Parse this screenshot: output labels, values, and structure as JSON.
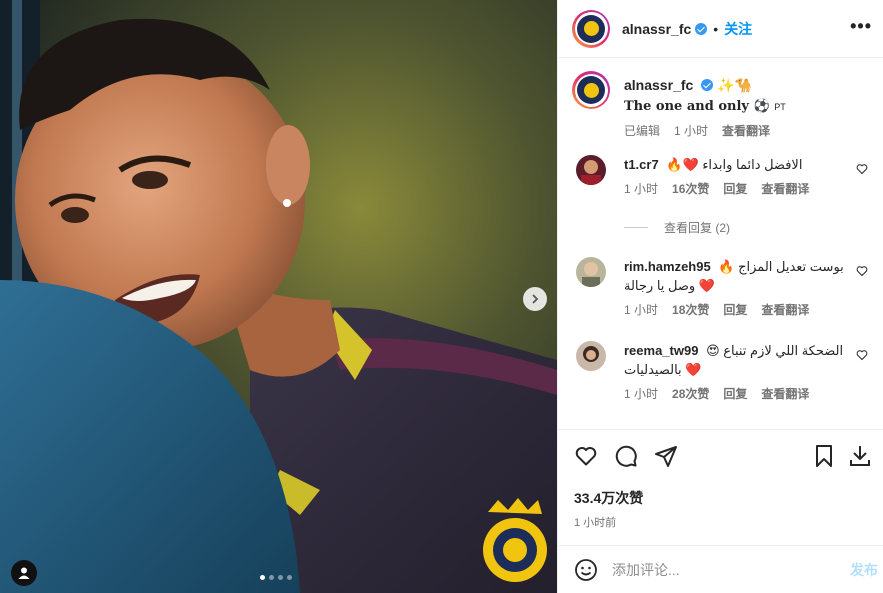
{
  "header": {
    "username": "alnassr_fc",
    "separator": "•",
    "follow_label": "关注",
    "more_label": "•••"
  },
  "caption": {
    "username": "alnassr_fc",
    "emoji": "✨🐪",
    "text": "The one and only ⚽",
    "tag": "PT",
    "edited": "已编辑",
    "time": "1 小时",
    "translate": "查看翻译"
  },
  "comments": [
    {
      "username": "t1.cr7",
      "text": "الافضل دائما وابداء ❤️🔥",
      "time": "1 小时",
      "likes": "16次赞",
      "reply": "回复",
      "translate": "查看翻译"
    },
    {
      "username": "rim.hamzeh95",
      "text": "بوست تعديل المزاج 🔥❤️ وصل يا رجالة",
      "time": "1 小时",
      "likes": "18次赞",
      "reply": "回复",
      "translate": "查看翻译"
    },
    {
      "username": "reema_tw99",
      "text": "الضحكة اللي لازم تنباع 😍❤️ بالصيدليات",
      "time": "1 小时",
      "likes": "28次赞",
      "reply": "回复",
      "translate": "查看翻译"
    }
  ],
  "view_replies": "查看回复 (2)",
  "likes_count": "33.4万次赞",
  "post_time": "1 小时前",
  "add_comment": {
    "placeholder": "添加评论...",
    "post_label": "发布"
  },
  "carousel": {
    "slides": 4,
    "active": 1
  },
  "colors": {
    "accent": "#0095f6",
    "verified": "#3897f0",
    "jersey_yellow": "#f1c40f",
    "jersey_navy": "#1c2d5a"
  }
}
